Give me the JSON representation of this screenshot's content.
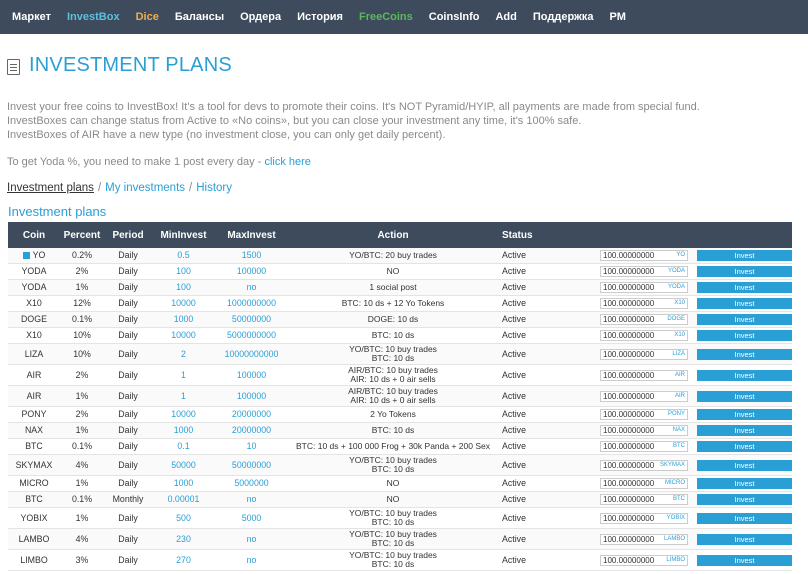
{
  "nav": [
    {
      "label": "Маркет",
      "color": "white"
    },
    {
      "label": "InvestBox",
      "color": "blue"
    },
    {
      "label": "Dice",
      "color": "orange"
    },
    {
      "label": "Балансы",
      "color": "white"
    },
    {
      "label": "Ордера",
      "color": "white"
    },
    {
      "label": "История",
      "color": "white"
    },
    {
      "label": "FreeCoins",
      "color": "green"
    },
    {
      "label": "CoinsInfo",
      "color": "white"
    },
    {
      "label": "Add",
      "color": "white"
    },
    {
      "label": "Поддержка",
      "color": "white"
    },
    {
      "label": "PM",
      "color": "white"
    }
  ],
  "page": {
    "title": "INVESTMENT PLANS",
    "intro_1": "Invest your free coins to InvestBox! It's a tool for devs to promote their coins. It's NOT Pyramid/HYIP, all payments are made from special fund.",
    "intro_2": "InvestBoxes can change status from Active to «No coins», but you can close your investment any time, it's 100% safe.",
    "intro_3": "InvestBoxes of AIR have a new type (no investment close, you can only get daily percent).",
    "yoda_text": "To get Yoda %, you need to make 1 post every day - ",
    "yoda_link": "click here"
  },
  "breadcrumbs": {
    "current": "Investment plans",
    "link_1": "My investments",
    "link_2": "History",
    "separator": "/"
  },
  "section_title": "Investment plans",
  "table": {
    "headers": {
      "coin": "Coin",
      "percent": "Percent",
      "period": "Period",
      "mininvest": "MinInvest",
      "maxinvest": "MaxInvest",
      "action": "Action",
      "status": "Status"
    },
    "rows": [
      {
        "coin": "YO",
        "marker": true,
        "percent": "0.2%",
        "period": "Daily",
        "min": "0.5",
        "max": "1500",
        "action": [
          "YO/BTC: 20 buy trades"
        ],
        "status": "Active",
        "amount": "100.00000000",
        "cur": "YO",
        "btn": "Invest"
      },
      {
        "coin": "YODA",
        "percent": "2%",
        "period": "Daily",
        "min": "100",
        "max": "100000",
        "action": [
          "NO"
        ],
        "status": "Active",
        "amount": "100.00000000",
        "cur": "YODA",
        "btn": "Invest"
      },
      {
        "coin": "YODA",
        "percent": "1%",
        "period": "Daily",
        "min": "100",
        "max": "no",
        "action": [
          "1 social post"
        ],
        "status": "Active",
        "amount": "100.00000000",
        "cur": "YODA",
        "btn": "Invest"
      },
      {
        "coin": "X10",
        "percent": "12%",
        "period": "Daily",
        "min": "10000",
        "max": "1000000000",
        "action": [
          "BTC: 10 ds + 12 Yo Tokens"
        ],
        "status": "Active",
        "amount": "100.00000000",
        "cur": "X10",
        "btn": "Invest"
      },
      {
        "coin": "DOGE",
        "percent": "0.1%",
        "period": "Daily",
        "min": "1000",
        "max": "50000000",
        "action": [
          "DOGE: 10 ds"
        ],
        "status": "Active",
        "amount": "100.00000000",
        "cur": "DOGE",
        "btn": "Invest"
      },
      {
        "coin": "X10",
        "percent": "10%",
        "period": "Daily",
        "min": "10000",
        "max": "5000000000",
        "action": [
          "BTC: 10 ds"
        ],
        "status": "Active",
        "amount": "100.00000000",
        "cur": "X10",
        "btn": "Invest"
      },
      {
        "coin": "LIZA",
        "percent": "10%",
        "period": "Daily",
        "min": "2",
        "max": "10000000000",
        "action": [
          "YO/BTC: 10 buy trades",
          "BTC: 10 ds"
        ],
        "status": "Active",
        "amount": "100.00000000",
        "cur": "LIZA",
        "btn": "Invest"
      },
      {
        "coin": "AIR",
        "percent": "2%",
        "period": "Daily",
        "min": "1",
        "max": "100000",
        "action": [
          "AIR/BTC: 10 buy trades",
          "AIR: 10 ds + 0 air sells"
        ],
        "status": "Active",
        "amount": "100.00000000",
        "cur": "AIR",
        "btn": "Invest"
      },
      {
        "coin": "AIR",
        "percent": "1%",
        "period": "Daily",
        "min": "1",
        "max": "100000",
        "action": [
          "AIR/BTC: 10 buy trades",
          "AIR: 10 ds + 0 air sells"
        ],
        "status": "Active",
        "amount": "100.00000000",
        "cur": "AIR",
        "btn": "Invest"
      },
      {
        "coin": "PONY",
        "percent": "2%",
        "period": "Daily",
        "min": "10000",
        "max": "20000000",
        "action": [
          "2 Yo Tokens"
        ],
        "status": "Active",
        "amount": "100.00000000",
        "cur": "PONY",
        "btn": "Invest"
      },
      {
        "coin": "NAX",
        "percent": "1%",
        "period": "Daily",
        "min": "1000",
        "max": "20000000",
        "action": [
          "BTC: 10 ds"
        ],
        "status": "Active",
        "amount": "100.00000000",
        "cur": "NAX",
        "btn": "Invest"
      },
      {
        "coin": "BTC",
        "percent": "0.1%",
        "period": "Daily",
        "min": "0.1",
        "max": "10",
        "action": [
          "BTC: 10 ds + 100 000 Frog + 30k Panda + 200 Sex"
        ],
        "status": "Active",
        "amount": "100.00000000",
        "cur": "BTC",
        "btn": "Invest"
      },
      {
        "coin": "SKYMAX",
        "percent": "4%",
        "period": "Daily",
        "min": "50000",
        "max": "50000000",
        "action": [
          "YO/BTC: 10 buy trades",
          "BTC: 10 ds"
        ],
        "status": "Active",
        "amount": "100.00000000",
        "cur": "SKYMAX",
        "btn": "Invest"
      },
      {
        "coin": "MICRO",
        "percent": "1%",
        "period": "Daily",
        "min": "1000",
        "max": "5000000",
        "action": [
          "NO"
        ],
        "status": "Active",
        "amount": "100.00000000",
        "cur": "MICRO",
        "btn": "Invest"
      },
      {
        "coin": "BTC",
        "percent": "0.1%",
        "period": "Monthly",
        "min": "0.00001",
        "max": "no",
        "action": [
          "NO"
        ],
        "status": "Active",
        "amount": "100.00000000",
        "cur": "BTC",
        "btn": "Invest"
      },
      {
        "coin": "YOBIX",
        "percent": "1%",
        "period": "Daily",
        "min": "500",
        "max": "5000",
        "action": [
          "YO/BTC: 10 buy trades",
          "BTC: 10 ds"
        ],
        "status": "Active",
        "amount": "100.00000000",
        "cur": "YOBIX",
        "btn": "Invest"
      },
      {
        "coin": "LAMBO",
        "percent": "4%",
        "period": "Daily",
        "min": "230",
        "max": "no",
        "action": [
          "YO/BTC: 10 buy trades",
          "BTC: 10 ds"
        ],
        "status": "Active",
        "amount": "100.00000000",
        "cur": "LAMBO",
        "btn": "Invest"
      },
      {
        "coin": "LIMBO",
        "percent": "3%",
        "period": "Daily",
        "min": "270",
        "max": "no",
        "action": [
          "YO/BTC: 10 buy trades",
          "BTC: 10 ds"
        ],
        "status": "Active",
        "amount": "100.00000000",
        "cur": "LIMBO",
        "btn": "Invest"
      }
    ]
  }
}
